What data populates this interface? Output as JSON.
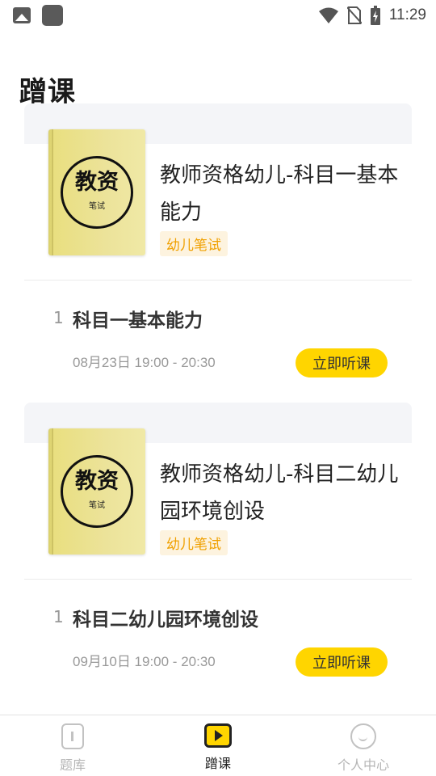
{
  "status_bar": {
    "time": "11:29",
    "icons": [
      "image-icon",
      "app-square-icon",
      "wifi-icon",
      "no-sim-icon",
      "battery-charging-icon"
    ]
  },
  "page": {
    "title": "蹭课"
  },
  "courses": [
    {
      "title": "教师资格幼儿-科目一基本能力",
      "tag": "幼儿笔试",
      "cover": {
        "big_text": "教资",
        "small_text": "笔试"
      },
      "lessons": [
        {
          "index": "1",
          "title": "科目一基本能力",
          "time": "08月23日 19:00 - 20:30",
          "button_label": "立即听课"
        }
      ]
    },
    {
      "title": "教师资格幼儿-科目二幼儿园环境创设",
      "tag": "幼儿笔试",
      "cover": {
        "big_text": "教资",
        "small_text": "笔试"
      },
      "lessons": [
        {
          "index": "1",
          "title": "科目二幼儿园环境创设",
          "time": "09月10日 19:00 - 20:30",
          "button_label": "立即听课"
        }
      ]
    }
  ],
  "bottom_nav": {
    "items": [
      {
        "label": "题库",
        "icon": "question-bank-icon",
        "active": false
      },
      {
        "label": "蹭课",
        "icon": "play-video-icon",
        "active": true
      },
      {
        "label": "个人中心",
        "icon": "smile-face-icon",
        "active": false
      }
    ]
  },
  "colors": {
    "accent": "#ffd500",
    "tag_text": "#f0a000",
    "tag_bg": "#fdf3df",
    "section_bg": "#f4f5f8"
  }
}
